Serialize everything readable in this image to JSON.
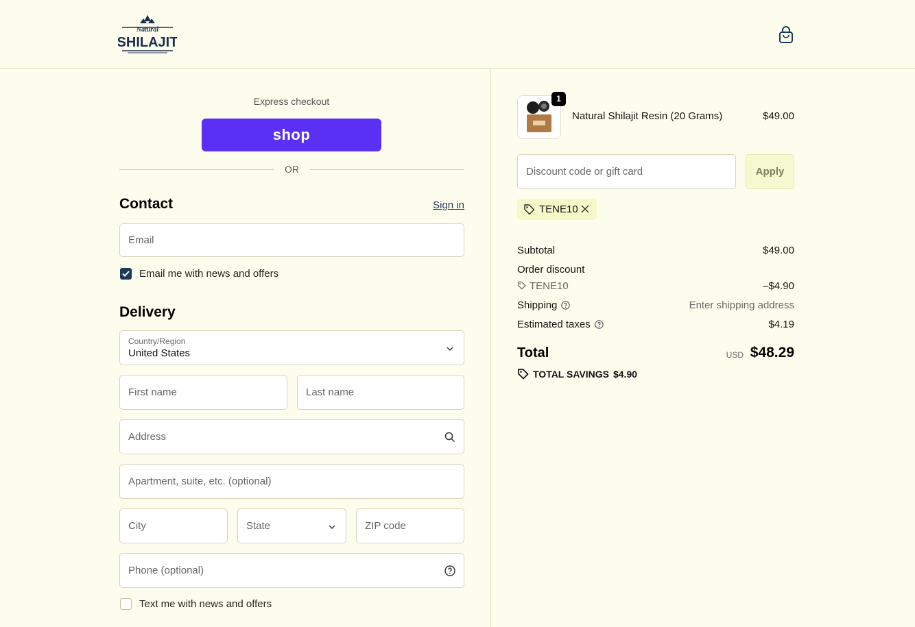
{
  "header": {
    "logo_top": "Natural",
    "logo_main": "SHILAJIT",
    "cart_icon": "shopping-bag-icon"
  },
  "express": {
    "label": "Express checkout",
    "shop_button": "shop",
    "shop_color": "#5a31f4",
    "or_text": "OR"
  },
  "contact": {
    "title": "Contact",
    "sign_in": "Sign in",
    "email_placeholder": "Email",
    "newsletter_label": "Email me with news and offers",
    "newsletter_checked": true
  },
  "delivery": {
    "title": "Delivery",
    "country_label": "Country/Region",
    "country_value": "United States",
    "first_name_placeholder": "First name",
    "last_name_placeholder": "Last name",
    "address_placeholder": "Address",
    "apartment_placeholder": "Apartment, suite, etc. (optional)",
    "city_placeholder": "City",
    "state_placeholder": "State",
    "zip_placeholder": "ZIP code",
    "phone_placeholder": "Phone (optional)",
    "sms_label": "Text me with news and offers",
    "sms_checked": false
  },
  "order": {
    "product_name": "Natural Shilajit Resin (20 Grams)",
    "product_price": "$49.00",
    "quantity": "1",
    "discount_placeholder": "Discount code or gift card",
    "apply_label": "Apply",
    "applied_code": "TENE10",
    "subtotal_label": "Subtotal",
    "subtotal_value": "$49.00",
    "order_discount_label": "Order discount",
    "order_discount_code": "TENE10",
    "order_discount_value": "–$4.90",
    "shipping_label": "Shipping",
    "shipping_value": "Enter shipping address",
    "taxes_label": "Estimated taxes",
    "taxes_value": "$4.19",
    "total_label": "Total",
    "currency": "USD",
    "total_value": "$48.29",
    "savings_label": "TOTAL SAVINGS",
    "savings_value": "$4.90"
  },
  "colors": {
    "background": "#fdfdee",
    "accent": "#1e3a56",
    "chip": "#f6f8c8"
  }
}
